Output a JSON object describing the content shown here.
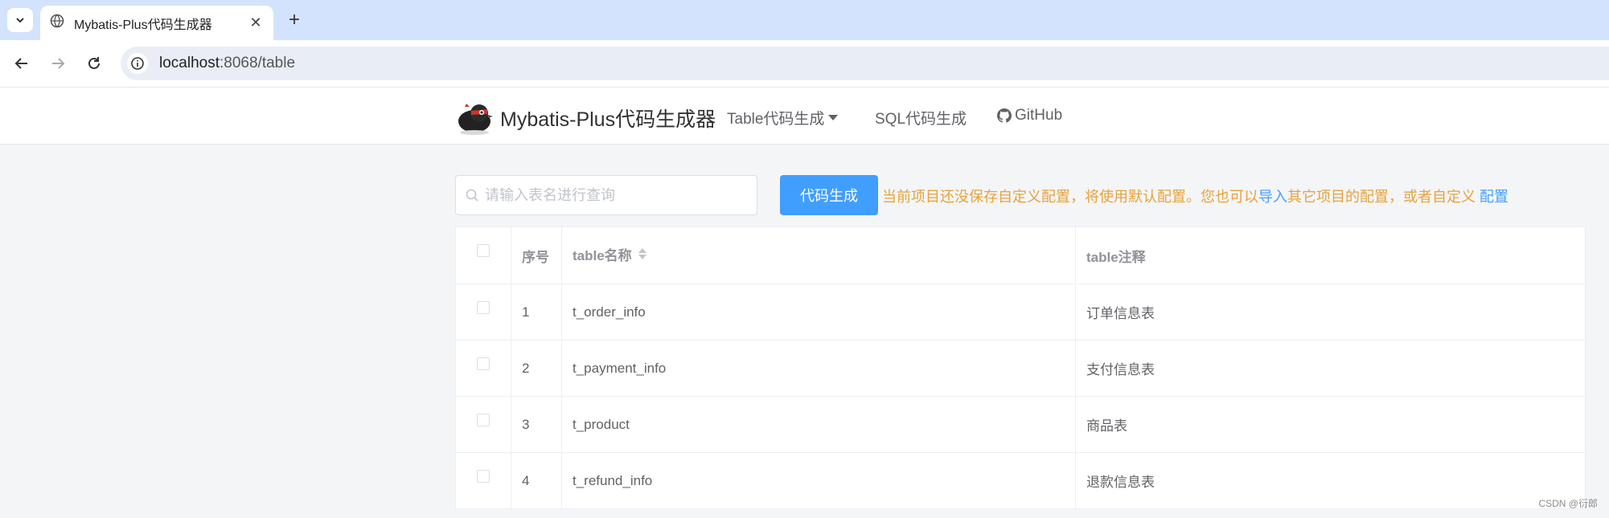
{
  "browser": {
    "tab_title": "Mybatis-Plus代码生成器",
    "url_host": "localhost",
    "url_rest": ":8068/table"
  },
  "header": {
    "brand": "Mybatis-Plus代码生成器",
    "menu": [
      {
        "label": "Table代码生成"
      },
      {
        "label": "SQL代码生成"
      },
      {
        "label": "GitHub"
      }
    ]
  },
  "toolbar": {
    "search_placeholder": "请输入表名进行查询",
    "generate_label": "代码生成",
    "notice_part1": "当前项目还没保存自定义配置，将使用默认配置。您也可以",
    "notice_import": "导入",
    "notice_part2": "其它项目的配置，或者自定义",
    "notice_config": "配置"
  },
  "table": {
    "headers": {
      "index": "序号",
      "name": "table名称",
      "comment": "table注释"
    },
    "rows": [
      {
        "index": "1",
        "name": "t_order_info",
        "comment": "订单信息表"
      },
      {
        "index": "2",
        "name": "t_payment_info",
        "comment": "支付信息表"
      },
      {
        "index": "3",
        "name": "t_product",
        "comment": "商品表"
      },
      {
        "index": "4",
        "name": "t_refund_info",
        "comment": "退款信息表"
      }
    ]
  },
  "watermark": "CSDN @衍郎",
  "colors": {
    "primary": "#409eff",
    "warning": "#e6a23c",
    "tabbar": "#d3e3fd"
  }
}
